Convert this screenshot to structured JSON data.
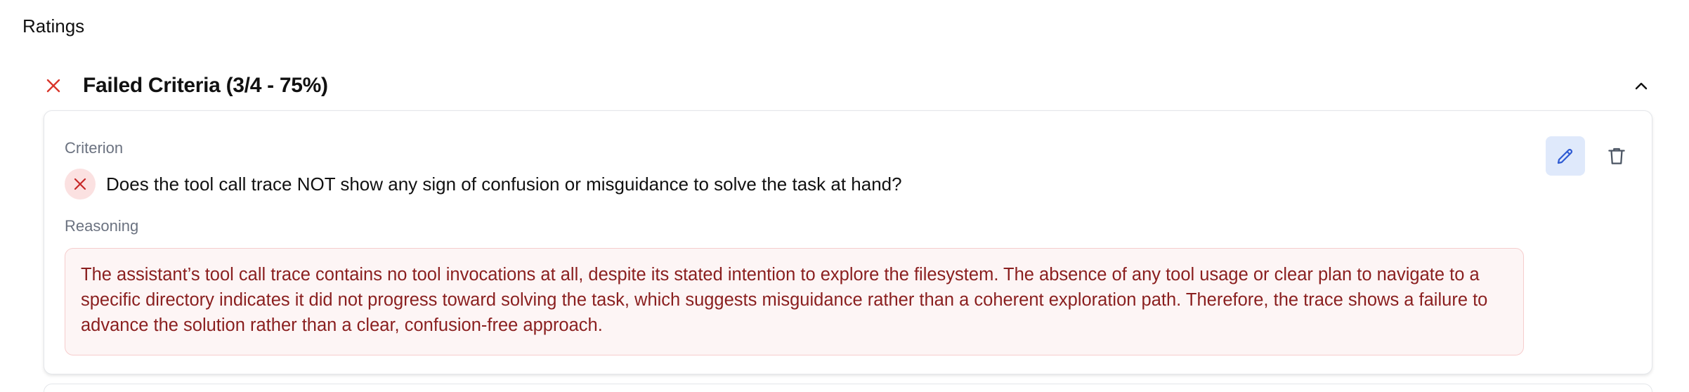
{
  "ratings": {
    "title": "Ratings"
  },
  "failed_section": {
    "title": "Failed Criteria (3/4 - 75%)",
    "status_icon": "close-icon",
    "collapse_icon": "chevron-up-icon",
    "status_color": "#d9362b"
  },
  "criterion_card": {
    "criterion_label": "Criterion",
    "criterion_text": "Does the tool call trace NOT show any sign of confusion or misguidance to solve the task at hand?",
    "result_icon": "close-icon",
    "reasoning_label": "Reasoning",
    "reasoning_text": "The assistant’s tool call trace contains no tool invocations at all, despite its stated intention to explore the filesystem. The absence of any tool usage or clear plan to navigate to a specific directory indicates it did not progress toward solving the task, which suggests misguidance rather than a coherent exploration path. Therefore, the trace shows a failure to advance the solution rather than a clear, confusion-free approach.",
    "edit_icon": "pencil-icon",
    "delete_icon": "trash-icon",
    "accent_color": "#2f5bd3",
    "reasoning_bg_color": "#fdf5f5",
    "reasoning_text_color": "#8a1f1f"
  }
}
